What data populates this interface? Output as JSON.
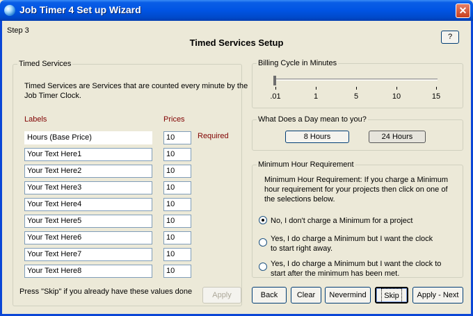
{
  "window": {
    "title": "Job Timer 4 Set up Wizard",
    "close_glyph": "✕"
  },
  "header": {
    "step": "Step 3",
    "title": "Timed Services Setup",
    "help_label": "?"
  },
  "timed_services": {
    "legend": "Timed Services",
    "description": "Timed Services are Services that are counted every minute by the Job Timer Clock.",
    "labels_header": "Labels",
    "prices_header": "Prices",
    "required_label": "Required",
    "rows": [
      {
        "label": "Hours (Base Price)",
        "price": "10"
      },
      {
        "label": "Your Text Here1",
        "price": "10"
      },
      {
        "label": "Your Text Here2",
        "price": "10"
      },
      {
        "label": "Your Text Here3",
        "price": "10"
      },
      {
        "label": "Your Text Here4",
        "price": "10"
      },
      {
        "label": "Your Text Here5",
        "price": "10"
      },
      {
        "label": "Your Text Here6",
        "price": "10"
      },
      {
        "label": "Your Text Here7",
        "price": "10"
      },
      {
        "label": "Your Text Here8",
        "price": "10"
      }
    ],
    "skip_note": "Press \"Skip\" if you already have these values done",
    "apply_label": "Apply"
  },
  "billing_cycle": {
    "legend": "Billing Cycle in Minutes",
    "ticks": [
      ".01",
      "1",
      "5",
      "10",
      "15"
    ],
    "selected": ".01"
  },
  "day_meaning": {
    "legend": "What Does a Day mean to you?",
    "option_8": "8 Hours",
    "option_24": "24 Hours",
    "selected": "24 Hours"
  },
  "minimum_hour": {
    "legend": "Minimum Hour Requirement",
    "description": "Minimum Hour Requirement: If you charge a Minimum hour requirement for your projects then click on one of the selections below.",
    "options": [
      "No, I don't charge a Minimum for a project",
      "Yes, I do charge a Minimum but I want the clock to start right away.",
      "Yes, I do charge a Minimum but I want the clock to start after the minimum has been met."
    ],
    "selected_index": 0
  },
  "footer": {
    "back": "Back",
    "clear": "Clear",
    "nevermind": "Nevermind",
    "skip": "Skip",
    "apply_next": "Apply - Next"
  }
}
